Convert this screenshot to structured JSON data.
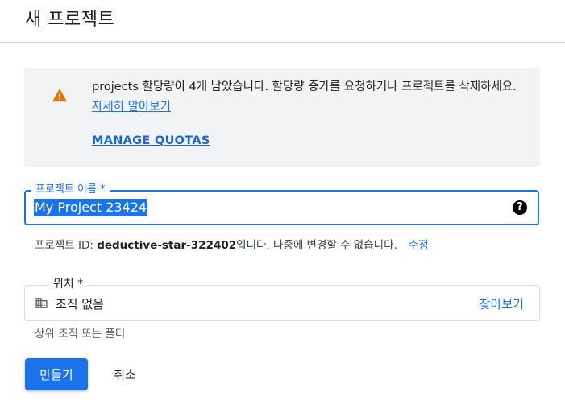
{
  "header": {
    "title": "새 프로젝트"
  },
  "quota_notice": {
    "icon": "warning-icon",
    "icon_color": "#e37400",
    "message": "projects 할당량이 4개 남았습니다. 할당량 증가를 요청하거나 프로젝트를 삭제하세요.",
    "learn_more": "자세히 알아보기",
    "manage_label": "MANAGE QUOTAS"
  },
  "project_name": {
    "label": "프로젝트 이름 *",
    "value": "My Project 23424",
    "help_icon": "help-icon"
  },
  "project_id": {
    "prefix": "프로젝트 ID: ",
    "id": "deductive-star-322402",
    "suffix": "입니다. 나중에 변경할 수 없습니다.",
    "edit_label": "수정"
  },
  "location": {
    "label": "위치 *",
    "icon": "organization-icon",
    "value": "조직 없음",
    "browse_label": "찾아보기",
    "helper": "상위 조직 또는 폴더"
  },
  "actions": {
    "create_label": "만들기",
    "cancel_label": "취소"
  },
  "colors": {
    "accent": "#1a73e8",
    "warning": "#e37400",
    "notice_bg": "#f1f3f4"
  }
}
